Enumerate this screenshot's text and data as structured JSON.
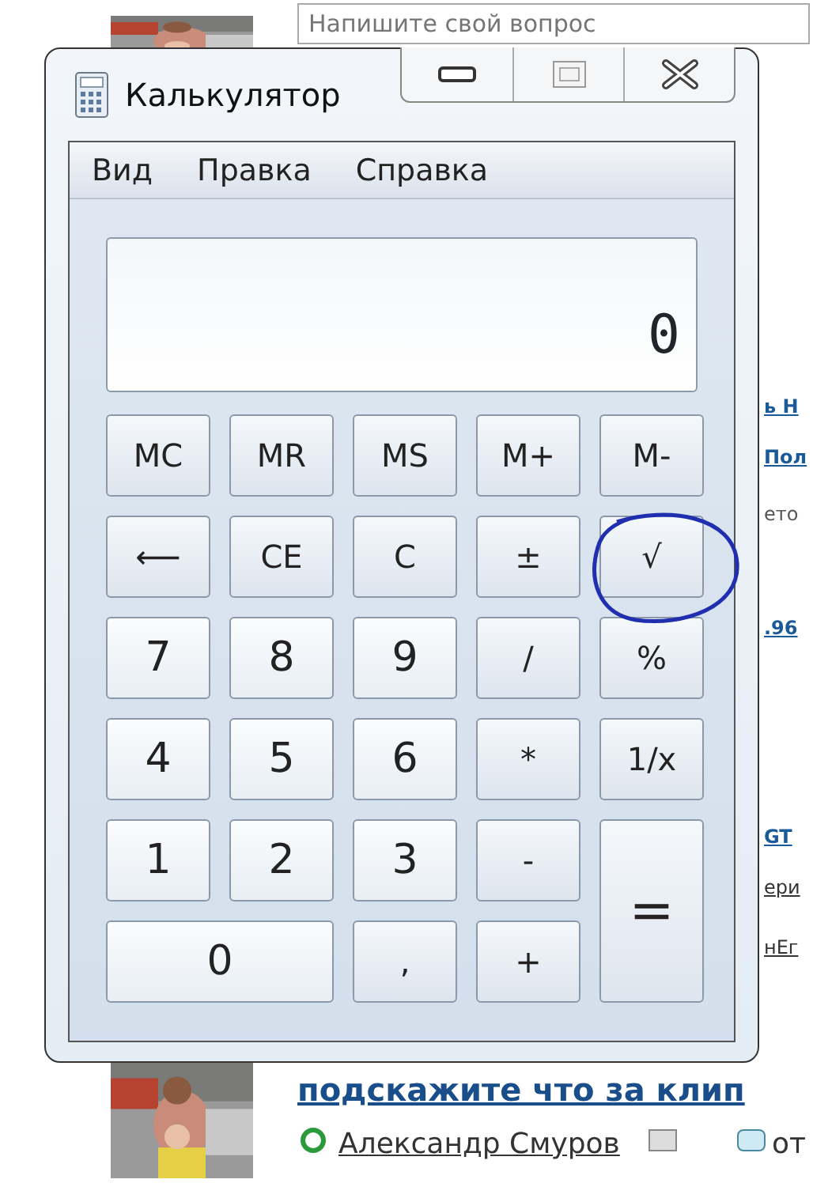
{
  "background_page": {
    "question_field": {
      "placeholder": "Напишите свой вопрос"
    },
    "fragments": [
      {
        "text": "ь Н",
        "kind": "link"
      },
      {
        "text": "Пол",
        "kind": "link"
      },
      {
        "text": "ето",
        "kind": "plain"
      },
      {
        "text": ".96",
        "kind": "link"
      },
      {
        "text": "GT",
        "kind": "link"
      },
      {
        "text": "ери",
        "kind": "under"
      },
      {
        "text": "нЕг",
        "kind": "under"
      }
    ],
    "post": {
      "title": "подскажите что за клип",
      "author": "Александр Смуров",
      "answers": "от"
    }
  },
  "window": {
    "title": "Калькулятор",
    "menu": [
      "Вид",
      "Правка",
      "Справка"
    ],
    "display": "0",
    "buttons": [
      {
        "label": "MC",
        "kind": "normal"
      },
      {
        "label": "MR",
        "kind": "normal"
      },
      {
        "label": "MS",
        "kind": "normal"
      },
      {
        "label": "M+",
        "kind": "normal"
      },
      {
        "label": "M-",
        "kind": "normal"
      },
      {
        "label": "⟵",
        "kind": "normal"
      },
      {
        "label": "CE",
        "kind": "normal"
      },
      {
        "label": "C",
        "kind": "normal"
      },
      {
        "label": "±",
        "kind": "normal"
      },
      {
        "label": "√",
        "kind": "normal"
      },
      {
        "label": "7",
        "kind": "digit"
      },
      {
        "label": "8",
        "kind": "digit"
      },
      {
        "label": "9",
        "kind": "digit"
      },
      {
        "label": "/",
        "kind": "normal"
      },
      {
        "label": "%",
        "kind": "normal"
      },
      {
        "label": "4",
        "kind": "digit"
      },
      {
        "label": "5",
        "kind": "digit"
      },
      {
        "label": "6",
        "kind": "digit"
      },
      {
        "label": "*",
        "kind": "normal"
      },
      {
        "label": "1/x",
        "kind": "normal"
      },
      {
        "label": "1",
        "kind": "digit"
      },
      {
        "label": "2",
        "kind": "digit"
      },
      {
        "label": "3",
        "kind": "digit"
      },
      {
        "label": "-",
        "kind": "normal"
      },
      {
        "label": "=",
        "kind": "tall"
      },
      {
        "label": "0",
        "kind": "wide"
      },
      {
        "label": ",",
        "kind": "normal"
      },
      {
        "label": "+",
        "kind": "normal"
      }
    ]
  }
}
